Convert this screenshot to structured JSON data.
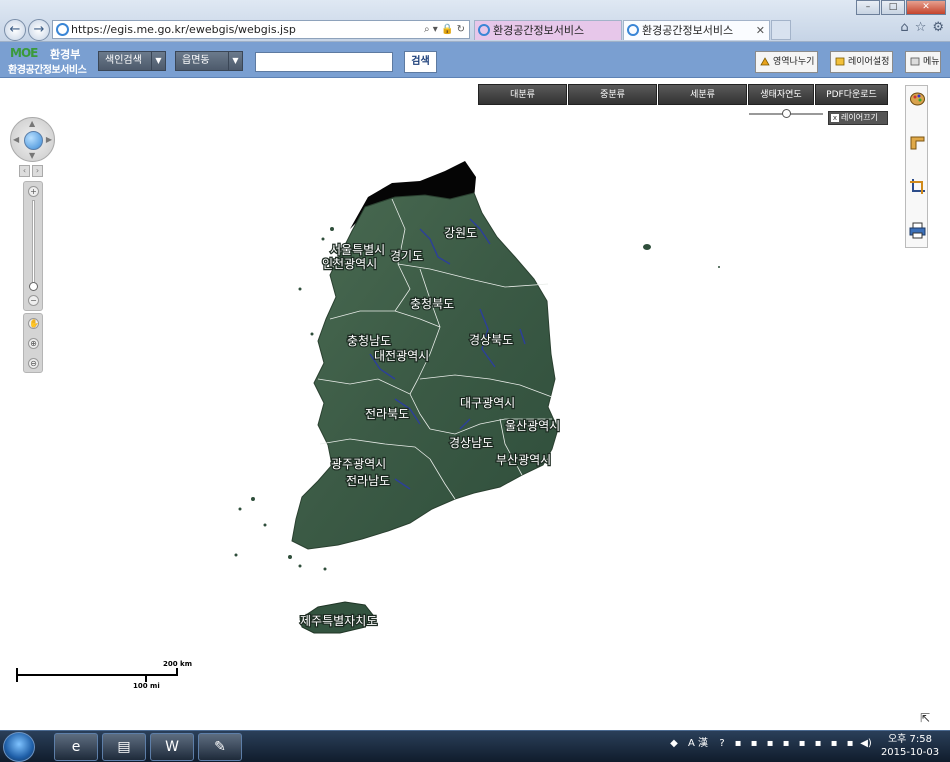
{
  "browser": {
    "url": "https://egis.me.go.kr/ewebgis/webgis.jsp",
    "tabs": [
      {
        "label": "환경공간정보서비스"
      },
      {
        "label": "환경공간정보서비스"
      }
    ]
  },
  "header": {
    "logo_mark": "MOE",
    "ministry": "환경부",
    "service": "환경공간정보서비스",
    "search_type_select": "색인검색",
    "region_select": "읍면동",
    "search_input_value": "",
    "search_button": "검색",
    "btn_area_split": "영역나누기",
    "btn_layer_settings": "레이어설정",
    "btn_extra": "메뉴"
  },
  "map": {
    "theme_tabs": [
      "대분류",
      "중분류",
      "세분류",
      "생태자연도",
      "PDF다운로드"
    ],
    "layer_off": "레이어끄기",
    "scale_km": "200 km",
    "scale_mi": "100 mi",
    "region_labels": [
      "서울특별시",
      "인천광역시",
      "경기도",
      "강원도",
      "충청북도",
      "충청남도",
      "대전광역시",
      "경상북도",
      "전라북도",
      "대구광역시",
      "울산광역시",
      "경상남도",
      "부산광역시",
      "광주광역시",
      "전라남도",
      "제주특별자치도"
    ]
  },
  "taskbar": {
    "time": "오후 7:58",
    "date": "2015-10-03",
    "ime": "A 漢"
  },
  "colors": {
    "app_bar": "#7a9fd1",
    "land": "#3f5e4a"
  }
}
